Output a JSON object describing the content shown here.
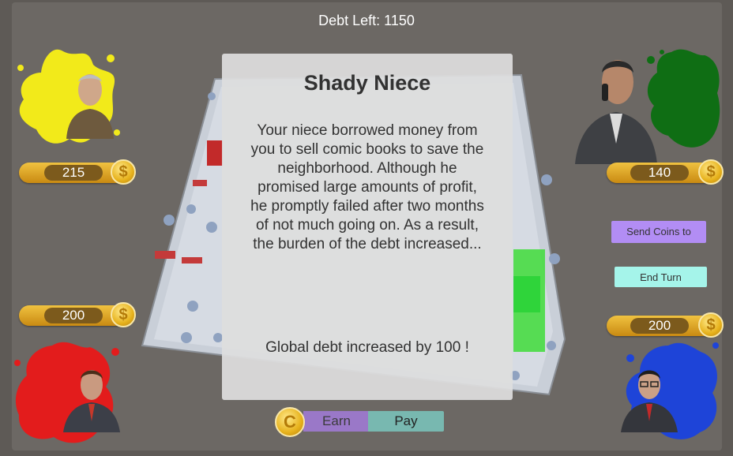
{
  "hud": {
    "debt_left": "Debt Left: 1150"
  },
  "players": [
    {
      "id": "yellow",
      "color": "#f2ea1a",
      "coins": "215"
    },
    {
      "id": "green",
      "color": "#0f6e14",
      "coins": "140"
    },
    {
      "id": "red",
      "color": "#e31c1c",
      "coins": "200"
    },
    {
      "id": "blue",
      "color": "#1e44d8",
      "coins": "200"
    }
  ],
  "event_card": {
    "title": "Shady Niece",
    "body": "Your niece borrowed money from you to sell comic books to save the neighborhood. Although he promised large amounts of profit, he promptly failed after two months of not much going on. As a result, the burden of the debt increased...",
    "result": "Global debt increased by 100 !"
  },
  "actions": {
    "send_coins": "Send Coins to",
    "end_turn": "End Turn",
    "earn": "Earn",
    "pay": "Pay"
  },
  "icons": {
    "coin_glyph": "$",
    "earn_coin_glyph": "C"
  },
  "colors": {
    "send_button": "#b28df4",
    "end_turn_button": "#a5f4ea",
    "coin_gold": "#e7b21c"
  }
}
